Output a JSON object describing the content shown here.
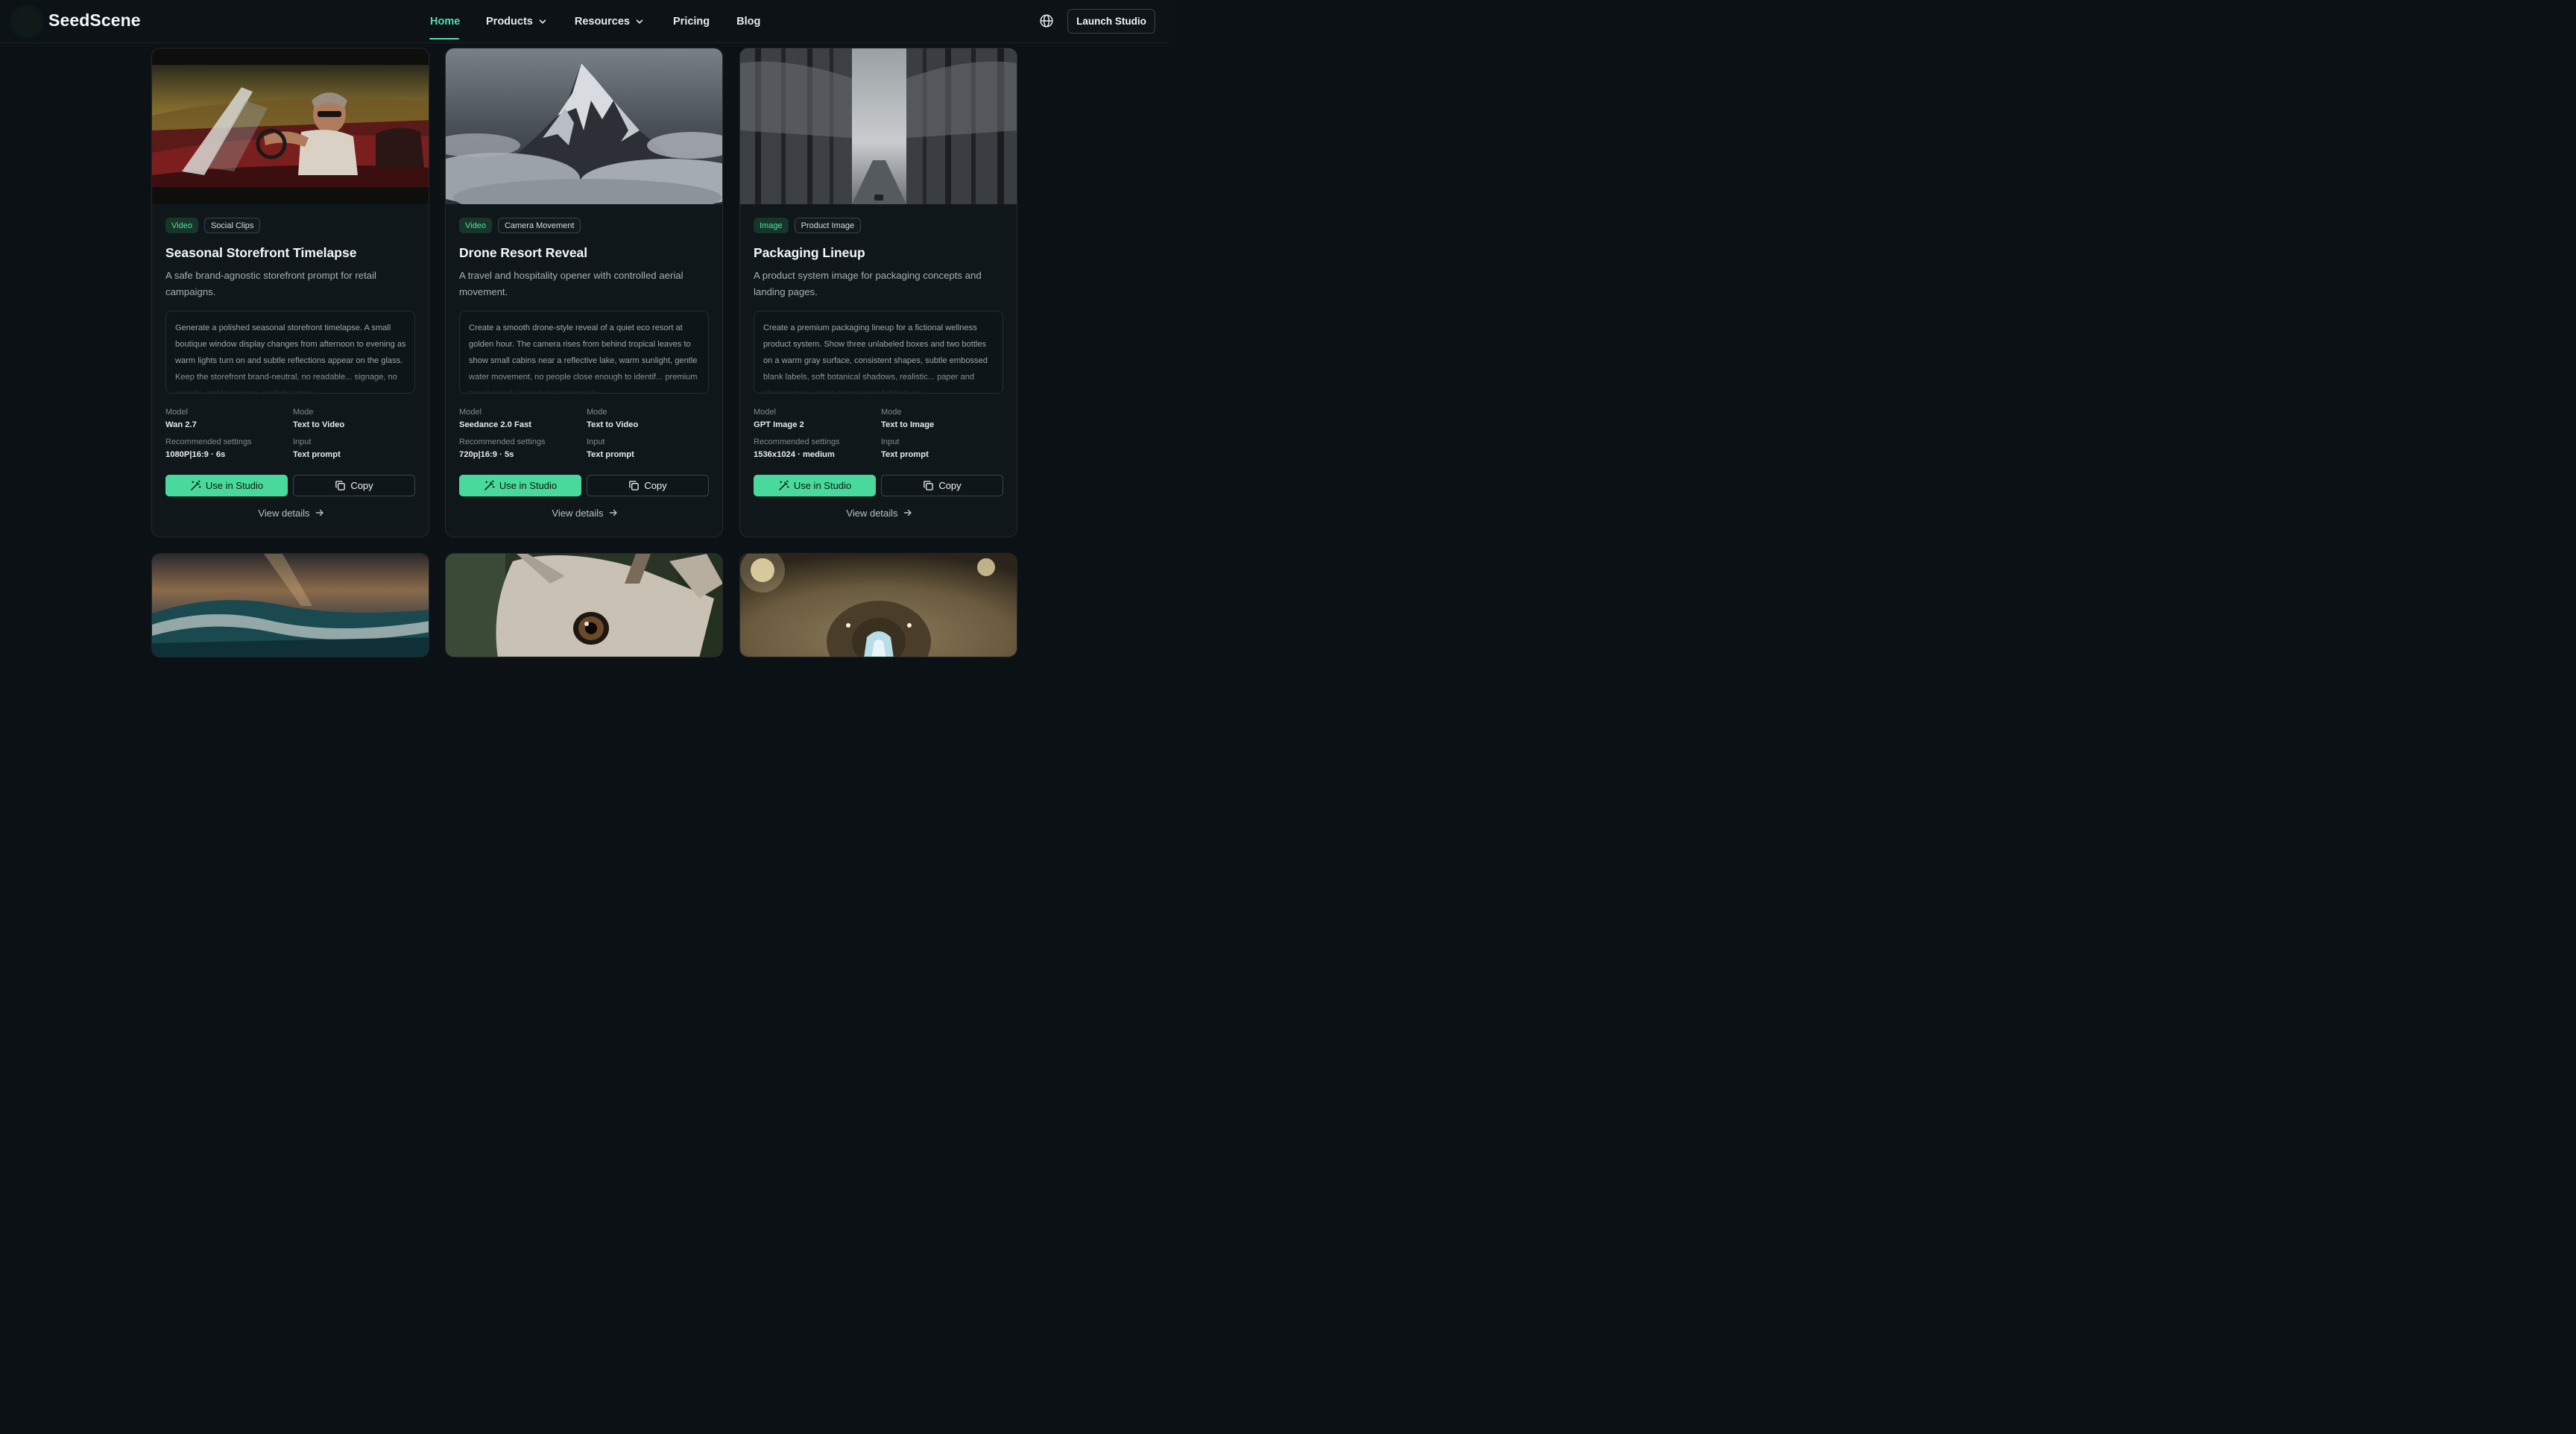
{
  "header": {
    "logo_text": "SeedScene",
    "nav": [
      {
        "label": "Home",
        "active": true
      },
      {
        "label": "Products",
        "dropdown": true
      },
      {
        "label": "Resources",
        "dropdown": true
      },
      {
        "label": "Pricing"
      },
      {
        "label": "Blog"
      }
    ],
    "language_icon": "globe-icon",
    "launch_label": "Launch Studio"
  },
  "labels": {
    "model": "Model",
    "mode": "Mode",
    "settings": "Recommended settings",
    "input": "Input",
    "use": "Use in Studio",
    "copy": "Copy",
    "view": "View details"
  },
  "cards": [
    {
      "kind": "Video",
      "category": "Social Clips",
      "title": "Seasonal Storefront Timelapse",
      "description": "A safe brand-agnostic storefront prompt for retail campaigns.",
      "prompt": "Generate a polished seasonal storefront timelapse. A small boutique window display changes from afternoon to evening as warm lights turn on and subtle reflections appear on the glass. Keep the storefront brand-neutral, no readable... signage, no crowds, stable camera, realistic urban",
      "model": "Wan 2.7",
      "mode": "Text to Video",
      "settings": "1080P|16:9 · 6s",
      "input": "Text prompt"
    },
    {
      "kind": "Video",
      "category": "Camera Movement",
      "title": "Drone Resort Reveal",
      "description": "A travel and hospitality opener with controlled aerial movement.",
      "prompt": "Create a smooth drone-style reveal of a quiet eco resort at golden hour. The camera rises from behind tropical leaves to show small cabins near a reflective lake, warm sunlight, gentle water movement, no people close enough to identif... premium travel mood, no text, no watermark",
      "model": "Seedance 2.0 Fast",
      "mode": "Text to Video",
      "settings": "720p|16:9 · 5s",
      "input": "Text prompt"
    },
    {
      "kind": "Image",
      "category": "Product Image",
      "title": "Packaging Lineup",
      "description": "A product system image for packaging concepts and landing pages.",
      "prompt": "Create a premium packaging lineup for a fictional wellness product system. Show three unlabeled boxes and two bottles on a warm gray surface, consistent shapes, subtle embossed blank labels, soft botanical shadows, realistic... paper and glass texture, clean commercial lighting, no",
      "model": "GPT Image 2",
      "mode": "Text to Image",
      "settings": "1536x1024 · medium",
      "input": "Text prompt"
    }
  ],
  "lower_cards": [
    {
      "thumbnail": "ocean-wave-sunset"
    },
    {
      "thumbnail": "antelope-eye-closeup"
    },
    {
      "thumbnail": "tunnel-lights"
    }
  ]
}
